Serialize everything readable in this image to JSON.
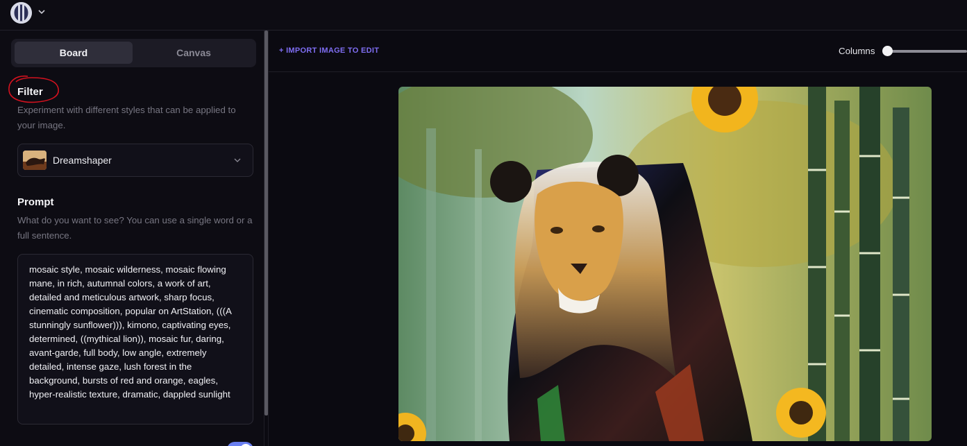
{
  "app": {
    "logo_icon": "app-logo-icon",
    "menu_icon": "chevron-down-icon"
  },
  "sidebar": {
    "tabs": [
      {
        "label": "Board",
        "active": true
      },
      {
        "label": "Canvas",
        "active": false
      }
    ],
    "filter": {
      "title": "Filter",
      "description": "Experiment with different styles that can be applied to your image.",
      "selected": "Dreamshaper",
      "annotation_color": "#d3121f"
    },
    "prompt": {
      "title": "Prompt",
      "description": "What do you want to see? You can use a single word or a full sentence.",
      "value": "mosaic style, mosaic wilderness, mosaic flowing mane, in rich, autumnal colors, a work of art, detailed and meticulous artwork, sharp focus, cinematic composition, popular on ArtStation, (((A stunningly sunflower))), kimono, captivating eyes, determined, ((mythical lion)), mosaic fur, daring, avant-garde, full body, low angle, extremely detailed, intense gaze, lush forest in the background, bursts of red and orange, eagles, hyper-realistic texture, dramatic, dappled sunlight"
    },
    "toggle": {
      "on": true,
      "color": "#6a7ff0"
    }
  },
  "main": {
    "import_label": "+ IMPORT IMAGE TO EDIT",
    "columns_label": "Columns",
    "columns_value": 0,
    "accent": "#7f6ef3"
  }
}
